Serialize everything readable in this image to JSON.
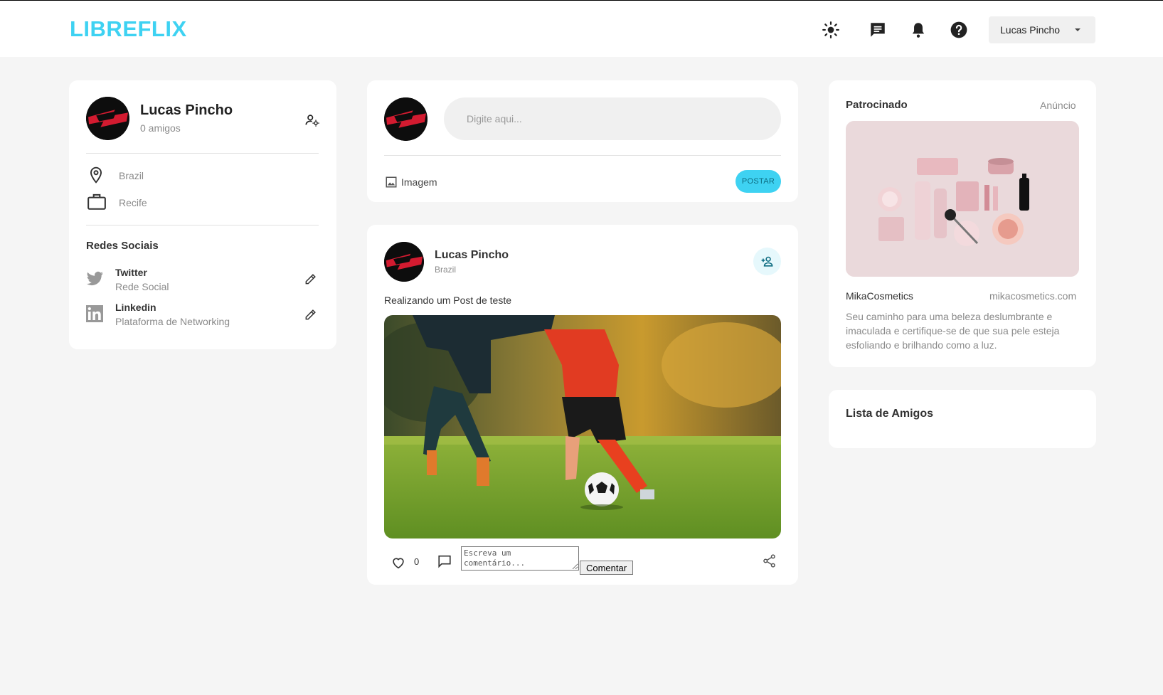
{
  "app": {
    "logo": "LIBREFLIX"
  },
  "navbar": {
    "user_menu_label": "Lucas Pincho",
    "icons": [
      "light-mode-icon",
      "message-icon",
      "notification-bell-icon",
      "help-icon",
      "chevron-down-icon"
    ]
  },
  "profile": {
    "name": "Lucas Pincho",
    "friends": "0 amigos",
    "location": "Brazil",
    "work": "Recife",
    "social_heading": "Redes Sociais",
    "social": [
      {
        "name": "Twitter",
        "subtitle": "Rede Social",
        "icon": "twitter-icon"
      },
      {
        "name": "Linkedin",
        "subtitle": "Plataforma de Networking",
        "icon": "linkedin-icon"
      }
    ]
  },
  "composer": {
    "placeholder": "Digite aqui...",
    "image_label": "Imagem",
    "post_button": "POSTAR"
  },
  "post": {
    "author": "Lucas Pincho",
    "location": "Brazil",
    "text": "Realizando um Post de teste",
    "likes": "0",
    "comment_placeholder": "Escreva um comentário...",
    "comment_button": "Comentar"
  },
  "sponsored": {
    "heading": "Patrocinado",
    "ad_label": "Anúncio",
    "brand": "MikaCosmetics",
    "url": "mikacosmetics.com",
    "description": "Seu caminho para uma beleza deslumbrante e imaculada e certifique-se de que sua pele esteja esfoliando e brilhando como a luz."
  },
  "friends_list": {
    "heading": "Lista de Amigos"
  },
  "colors": {
    "accent": "#3ed2f2",
    "background": "#f5f5f5",
    "card": "#ffffff"
  }
}
